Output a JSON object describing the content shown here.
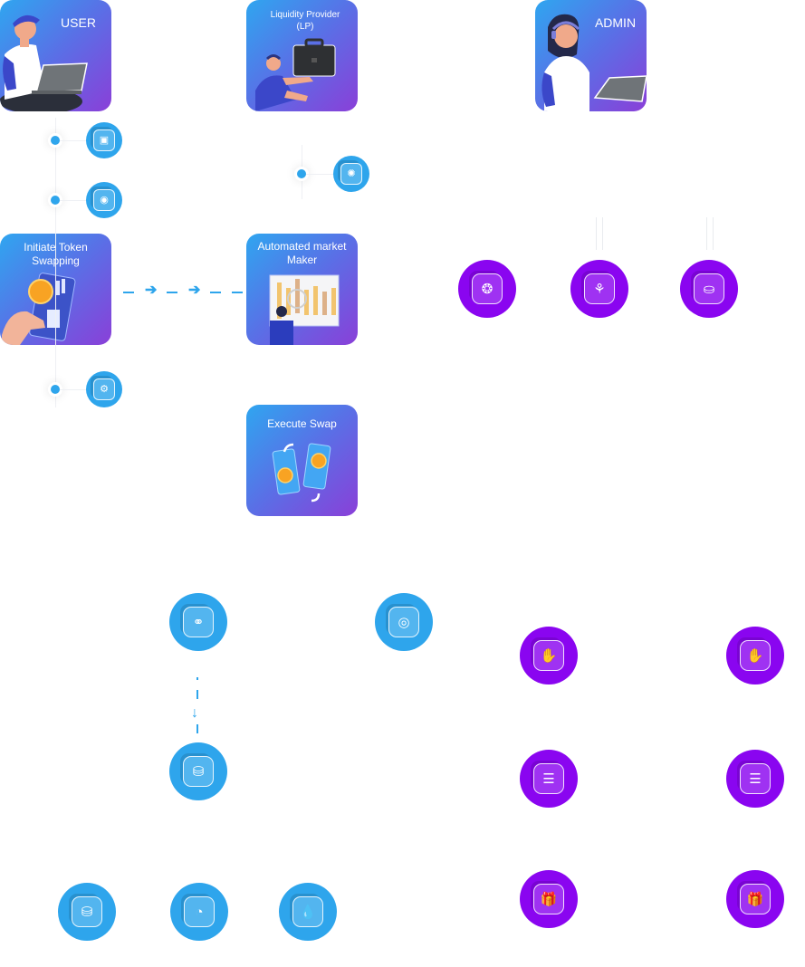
{
  "actors": {
    "user": {
      "label": "USER"
    },
    "lp": {
      "label": "Liquidity Provider (LP)"
    },
    "admin": {
      "label": "ADMIN"
    }
  },
  "steps": {
    "initiate": {
      "label": "Initiate Token Swapping"
    },
    "amm": {
      "label": "Automated market Maker"
    },
    "execute": {
      "label": "Execute Swap"
    }
  },
  "colors": {
    "blue_node": "#2ea5ec",
    "purple_node": "#8a05f0",
    "card_gradient_start": "#2fa6f0",
    "card_gradient_end": "#8a3fd8"
  },
  "icons": {
    "user_steps": [
      "wallet-icon",
      "user-account-icon",
      "token-search-icon"
    ],
    "lp_steps": [
      "liquidity-add-icon"
    ],
    "admin_steps": [
      "token-settings-icon",
      "growth-plant-icon",
      "coins-stack-icon"
    ],
    "flow_blue": [
      "token-pair-icon",
      "lp-token-icon",
      "receive-token-icon",
      "user-deposit-icon",
      "pool-share-icon",
      "liquidity-drop-icon"
    ],
    "flow_purple": [
      "hand-receive-icon",
      "hand-coin-icon",
      "coins-fee-icon",
      "coins-fee-icon",
      "gift-reward-icon",
      "gift-reward-icon"
    ]
  }
}
